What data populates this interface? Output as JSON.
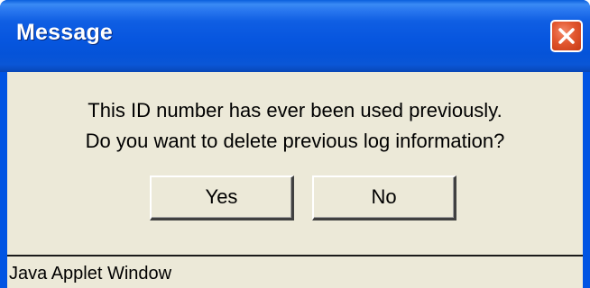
{
  "window": {
    "title": "Message",
    "close_icon": "close-icon",
    "colors": {
      "titlebar": "#0054e3",
      "close_button": "#e2572f",
      "client_background": "#ece9d8"
    }
  },
  "message": {
    "line1": "This ID number has ever been used previously.",
    "line2": "Do you want to delete previous log information?"
  },
  "buttons": {
    "yes_label": "Yes",
    "no_label": "No"
  },
  "status_bar": {
    "text": "Java Applet Window"
  }
}
